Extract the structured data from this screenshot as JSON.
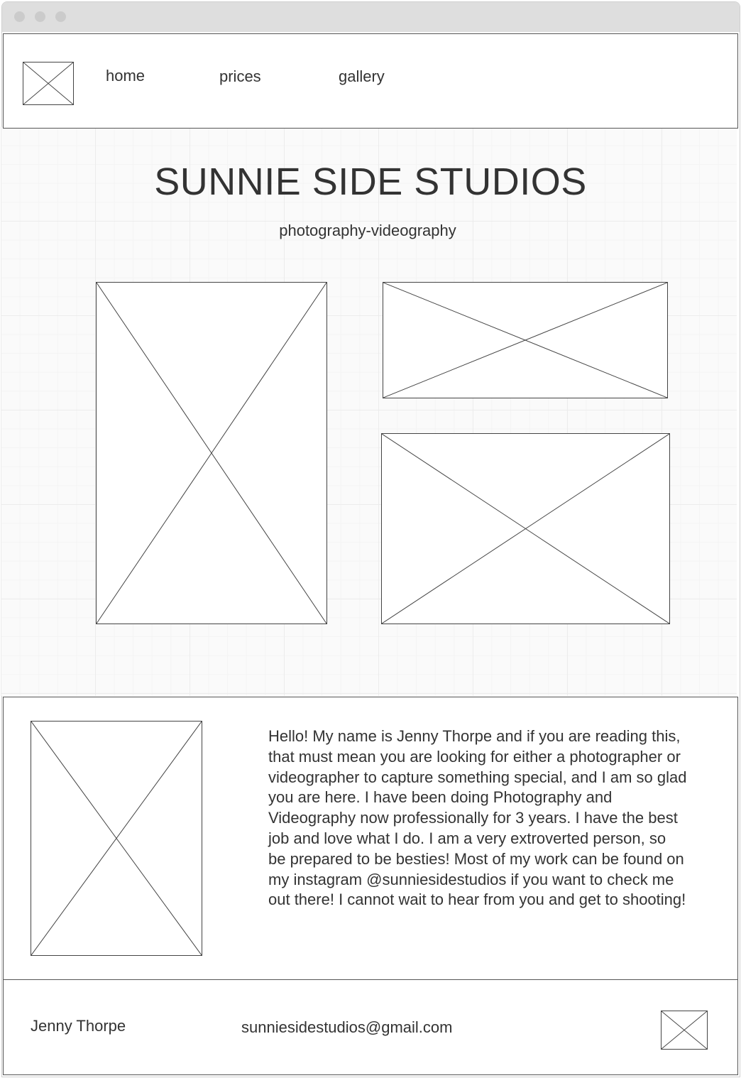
{
  "window": {
    "controls": [
      "close-dot",
      "minimize-dot",
      "maximize-dot"
    ]
  },
  "header": {
    "logo_icon": "image-placeholder-icon",
    "nav": {
      "home": "home",
      "prices": "prices",
      "gallery": "gallery"
    }
  },
  "hero": {
    "title": "SUNNIE SIDE STUDIOS",
    "subtitle": "photography-videography",
    "images": [
      "image-placeholder-icon",
      "image-placeholder-icon",
      "image-placeholder-icon"
    ]
  },
  "about": {
    "image": "image-placeholder-icon",
    "text": "Hello! My name is Jenny Thorpe and if you are reading this, that must mean you are looking for either a photographer or videographer to capture something special, and I am so glad you are here. I have been doing Photography and Videography now professionally for 3 years. I have the best job and love what I do. I am a very extroverted person, so be prepared to be besties! Most of my work can be found on my instagram @sunniesidestudios if you want to check me out there! I cannot wait to hear from you and get to shooting!"
  },
  "footer": {
    "name": "Jenny Thorpe",
    "email": "sunniesidestudios@gmail.com",
    "icon": "image-placeholder-icon"
  },
  "colors": {
    "text": "#333333",
    "border": "#444444",
    "titlebar": "#dedede",
    "grid": "#ececec"
  }
}
